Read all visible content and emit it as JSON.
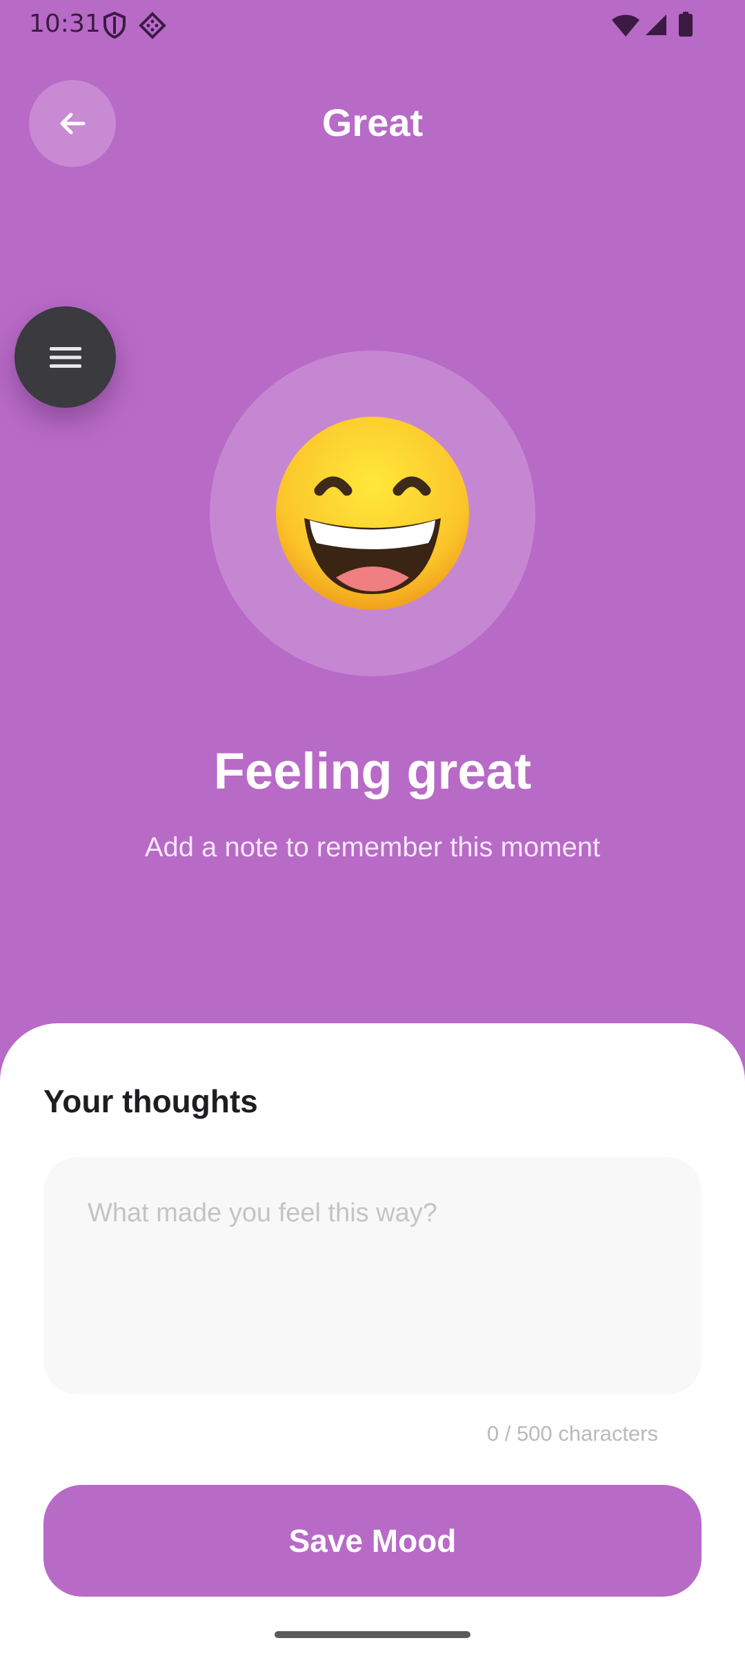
{
  "status_bar": {
    "time": "10:31"
  },
  "header": {
    "title": "Great"
  },
  "mood": {
    "emoji": "😄",
    "heading": "Feeling great",
    "subtitle": "Add a note to remember this moment"
  },
  "notes": {
    "label": "Your thoughts",
    "placeholder": "What made you feel this way?",
    "value": "",
    "counter": "0 / 500 characters"
  },
  "actions": {
    "save_label": "Save Mood"
  },
  "colors": {
    "background": "#b86ac7",
    "accent": "#b86ac7",
    "menu_button": "#3a3a3f"
  },
  "icons": {
    "back": "arrow-left-icon",
    "menu": "hamburger-menu-icon",
    "status": [
      "shield-icon",
      "dice-icon",
      "wifi-icon",
      "signal-icon",
      "battery-icon"
    ]
  }
}
